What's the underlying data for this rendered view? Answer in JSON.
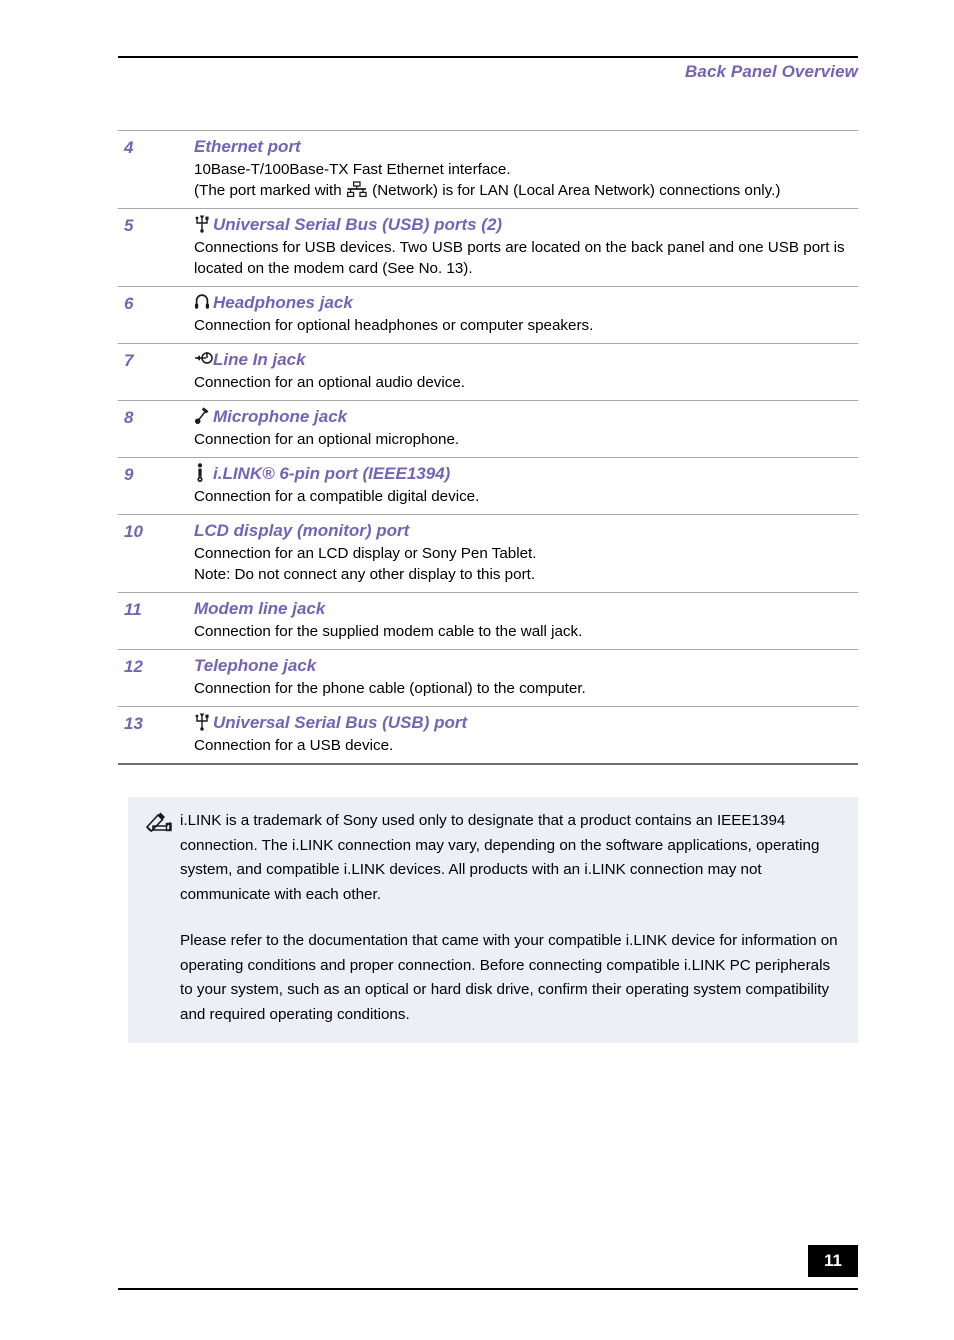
{
  "header": {
    "title": "Back Panel Overview"
  },
  "entries": [
    {
      "number": "4",
      "icon": "none",
      "title": "Ethernet port",
      "desc_lines": [
        "10Base-T/100Base-TX Fast Ethernet interface.",
        "(The port marked with ",
        " (Network) is for LAN (Local Area Network) connections only.)"
      ],
      "inline_icon": "network-icon"
    },
    {
      "number": "5",
      "icon": "usb-icon",
      "title": "Universal Serial Bus (USB) ports (2)",
      "desc_lines": [
        "Connections for USB devices. Two USB ports are located on the back panel and one USB port is located on the modem card (See No. 13)."
      ]
    },
    {
      "number": "6",
      "icon": "headphones-icon",
      "title": "Headphones jack",
      "desc_lines": [
        "Connection for optional headphones or computer speakers."
      ]
    },
    {
      "number": "7",
      "icon": "line-in-icon",
      "title": "Line In jack",
      "desc_lines": [
        "Connection for an optional audio device."
      ]
    },
    {
      "number": "8",
      "icon": "microphone-icon",
      "title": "Microphone jack",
      "desc_lines": [
        "Connection for an optional microphone."
      ]
    },
    {
      "number": "9",
      "icon": "ilink-icon",
      "title": "i.LINK® 6-pin port (IEEE1394)",
      "desc_lines": [
        "Connection for a compatible digital device."
      ]
    },
    {
      "number": "10",
      "icon": "none",
      "title": "LCD display (monitor) port",
      "desc_lines": [
        "Connection for an LCD display or Sony Pen Tablet.",
        "Note: Do not connect any other display to this port."
      ]
    },
    {
      "number": "11",
      "icon": "none",
      "title": "Modem line jack",
      "desc_lines": [
        "Connection for the supplied modem cable to the wall jack."
      ]
    },
    {
      "number": "12",
      "icon": "none",
      "title": "Telephone jack",
      "desc_lines": [
        "Connection for the phone cable (optional) to the computer."
      ]
    },
    {
      "number": "13",
      "icon": "usb-icon",
      "title": "Universal Serial Bus (USB) port",
      "desc_lines": [
        "Connection for a USB device."
      ]
    }
  ],
  "note": {
    "icon": "note-pencil-icon",
    "paragraph1": "i.LINK is a trademark of Sony used only to designate that a product contains an IEEE1394 connection. The i.LINK connection may vary, depending on the software applications, operating system, and compatible i.LINK devices. All products with an i.LINK connection may not communicate with each other.",
    "paragraph2": "Please refer to the documentation that came with your compatible i.LINK device for information on operating conditions and proper connection. Before connecting compatible i.LINK PC peripherals to your system, such as an optical or hard disk drive, confirm their operating system compatibility and required operating conditions."
  },
  "footer": {
    "page_number": "11"
  },
  "colors": {
    "accent_purple": "#7265b5",
    "note_background": "#eeeef6",
    "rule_gray": "#a8a8a8",
    "rule_dark": "#6f6f6f",
    "footer_badge": "#000000"
  }
}
